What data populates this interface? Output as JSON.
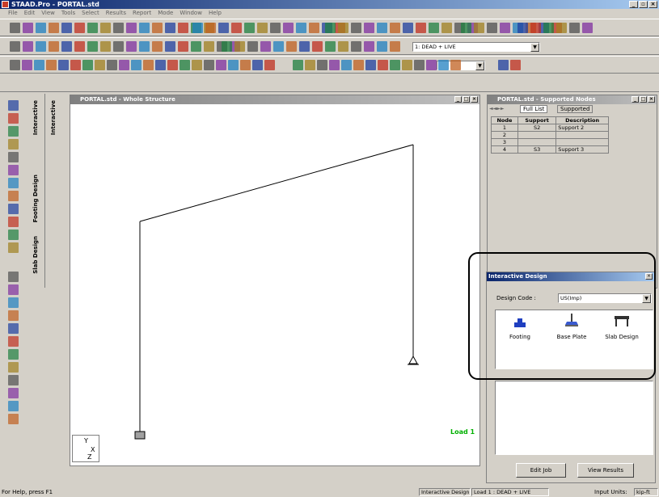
{
  "app": {
    "title": "STAAD.Pro - PORTAL.std"
  },
  "menu": [
    "File",
    "Edit",
    "View",
    "Tools",
    "Select",
    "Results",
    "Report",
    "Mode",
    "Window",
    "Help"
  ],
  "toolbar": {
    "load_combo": "1: DEAD + LIVE"
  },
  "side_tabs": [
    "Interactive",
    "Interactive",
    "Footing Design",
    "Slab Design"
  ],
  "structure_window": {
    "title": "PORTAL.std - Whole Structure",
    "load_label": "Load 1"
  },
  "nodes_window": {
    "title": "PORTAL.std - Supported Nodes",
    "tabs": [
      "Full List",
      "Supported"
    ],
    "columns": [
      "Node",
      "Support",
      "Description"
    ],
    "rows": [
      [
        "1",
        "S2",
        "Support 2"
      ],
      [
        "2",
        "",
        ""
      ],
      [
        "3",
        "",
        ""
      ],
      [
        "4",
        "S3",
        "Support 3"
      ]
    ]
  },
  "interactive_design": {
    "title": "Interactive Design",
    "code_label": "Design Code :",
    "code_value": "US(Imp)",
    "items": [
      "Footing",
      "Base Plate",
      "Slab Design"
    ],
    "edit_job": "Edit Job",
    "view_results": "View Results"
  },
  "status": {
    "help": "For Help, press F1",
    "mode": "Interactive Design",
    "load": "Load 1 : DEAD + LIVE",
    "units_label": "Input Units:",
    "units_value": "kip-ft"
  },
  "axis": {
    "y": "Y",
    "x": "X",
    "z": "Z"
  },
  "colors": {
    "title_left": "#0a246a",
    "load_label": "#00b000",
    "callout": "#000000"
  }
}
